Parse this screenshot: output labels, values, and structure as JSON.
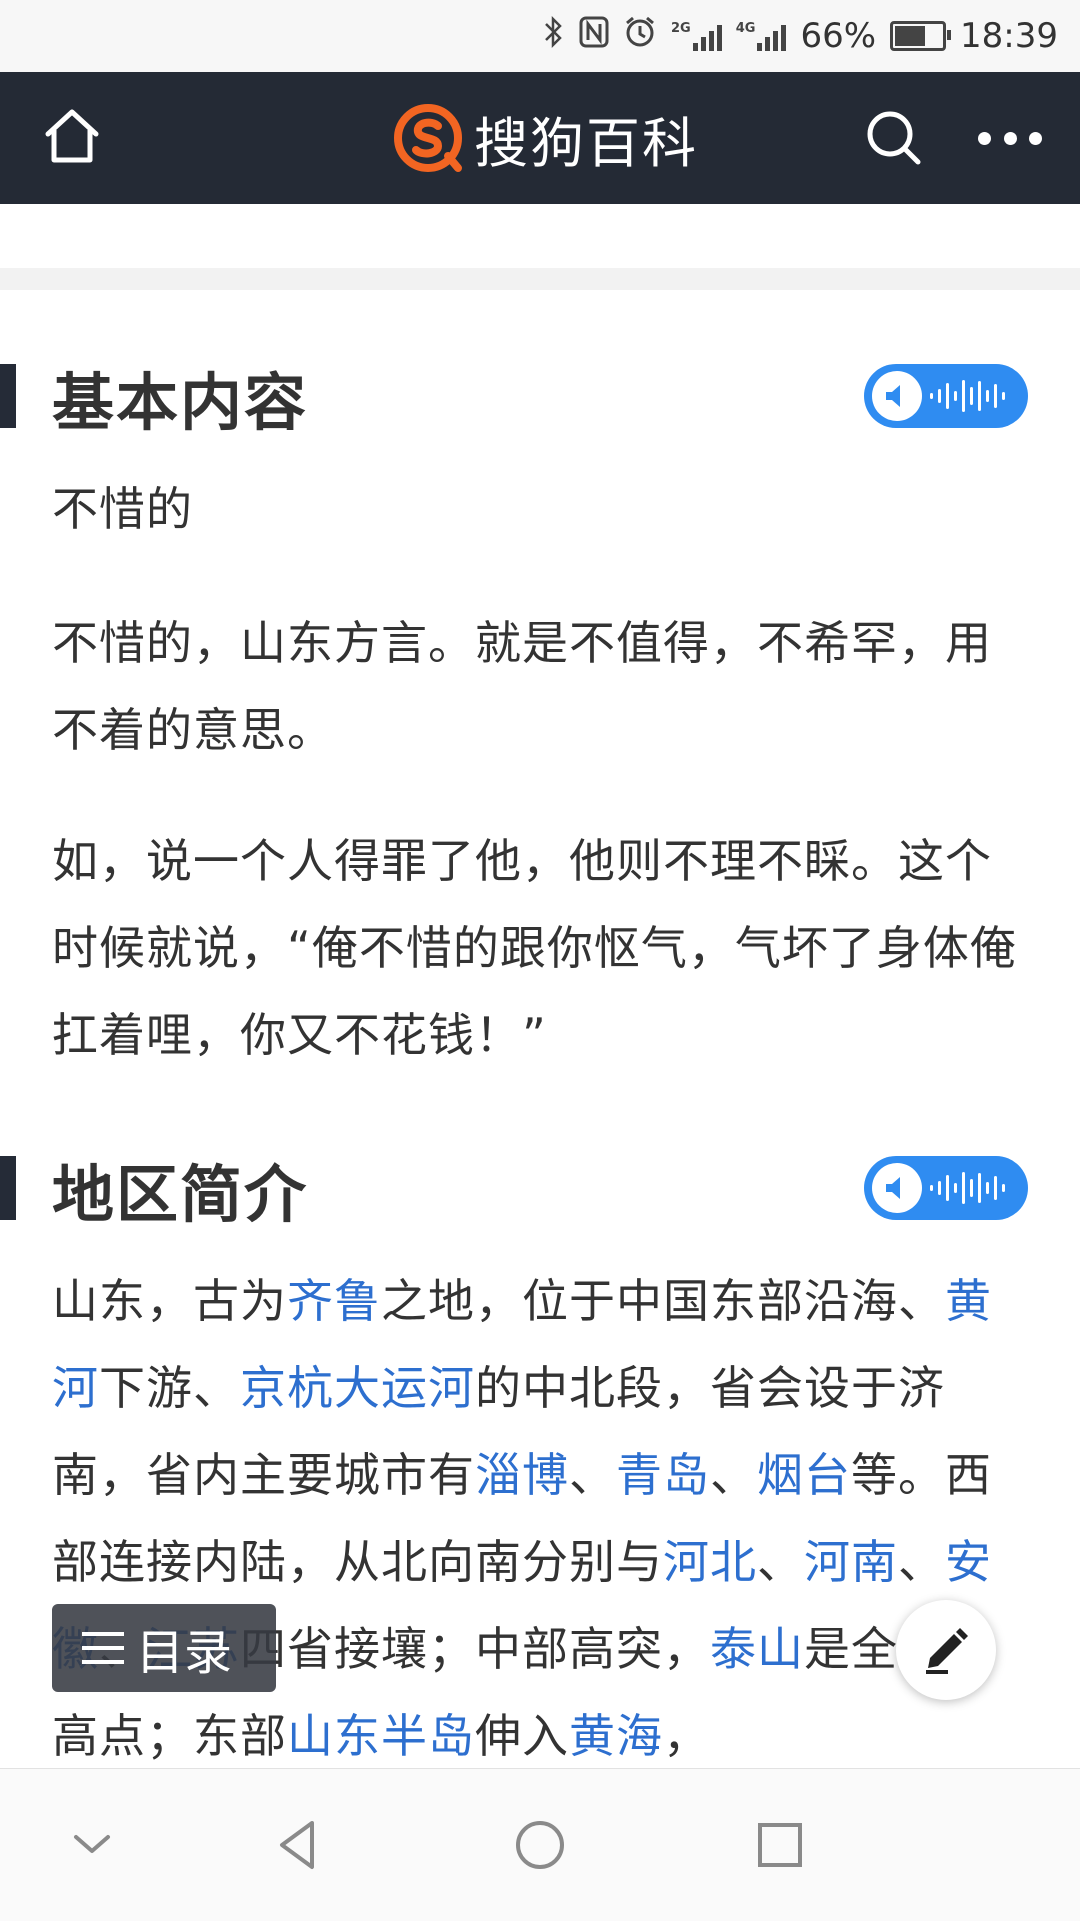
{
  "status_bar": {
    "battery": "66%",
    "time": "18:39",
    "net1": "2G",
    "net2": "4G",
    "icons": [
      "bluetooth-icon",
      "nfc-icon",
      "alarm-icon",
      "signal-icon",
      "signal-icon",
      "battery-icon"
    ]
  },
  "header": {
    "brand": "搜狗百科",
    "icons": [
      "home-icon",
      "sogou-logo",
      "search-icon",
      "more-icon"
    ],
    "color": "#242a35"
  },
  "sections": [
    {
      "title": "基本内容",
      "paragraphs": [
        "不惜的",
        "不惜的，山东方言。就是不值得，不希罕，用不着的意思。",
        "如，说一个人得罪了他，他则不理不睬。这个时候就说，“俺不惜的跟你怄气，气坏了身体俺扛着哩，你又不花钱！”"
      ]
    },
    {
      "title": "地区简介",
      "p1": {
        "t1": "山东，古为",
        "l1": "齐鲁",
        "t2": "之地，位于中国东部沿海、",
        "l2": "黄河",
        "t3": "下游、",
        "l3": "京杭大运河",
        "t4": "的中北段，省会设于济南，省内主要城市有",
        "l4": "淄博",
        "t5": "、",
        "l5": "青岛",
        "t6": "、",
        "l6": "烟台",
        "t7": "等。西部连接内陆，从北向南分别与",
        "l7": "河北",
        "t8": "、",
        "l8": "河南",
        "t9": "、",
        "l9": "安徽",
        "t10": "、",
        "l10": "江苏",
        "t11": "四省接壤；中部高突，",
        "l11": "泰山",
        "t12": "是全境最高点；东部",
        "l12": "山东半岛",
        "t13": "伸入",
        "l13": "黄海",
        "t14": "，"
      }
    }
  ],
  "floating": {
    "toc_label": "目录",
    "edit_icon": "pencil-icon"
  },
  "navbar": {
    "icons": [
      "chevron-down-icon",
      "back-icon",
      "home-circle-icon",
      "recents-icon"
    ]
  },
  "colors": {
    "link": "#2d6fcf",
    "audio": "#2f8cf1",
    "logo_orange": "#f26522"
  }
}
